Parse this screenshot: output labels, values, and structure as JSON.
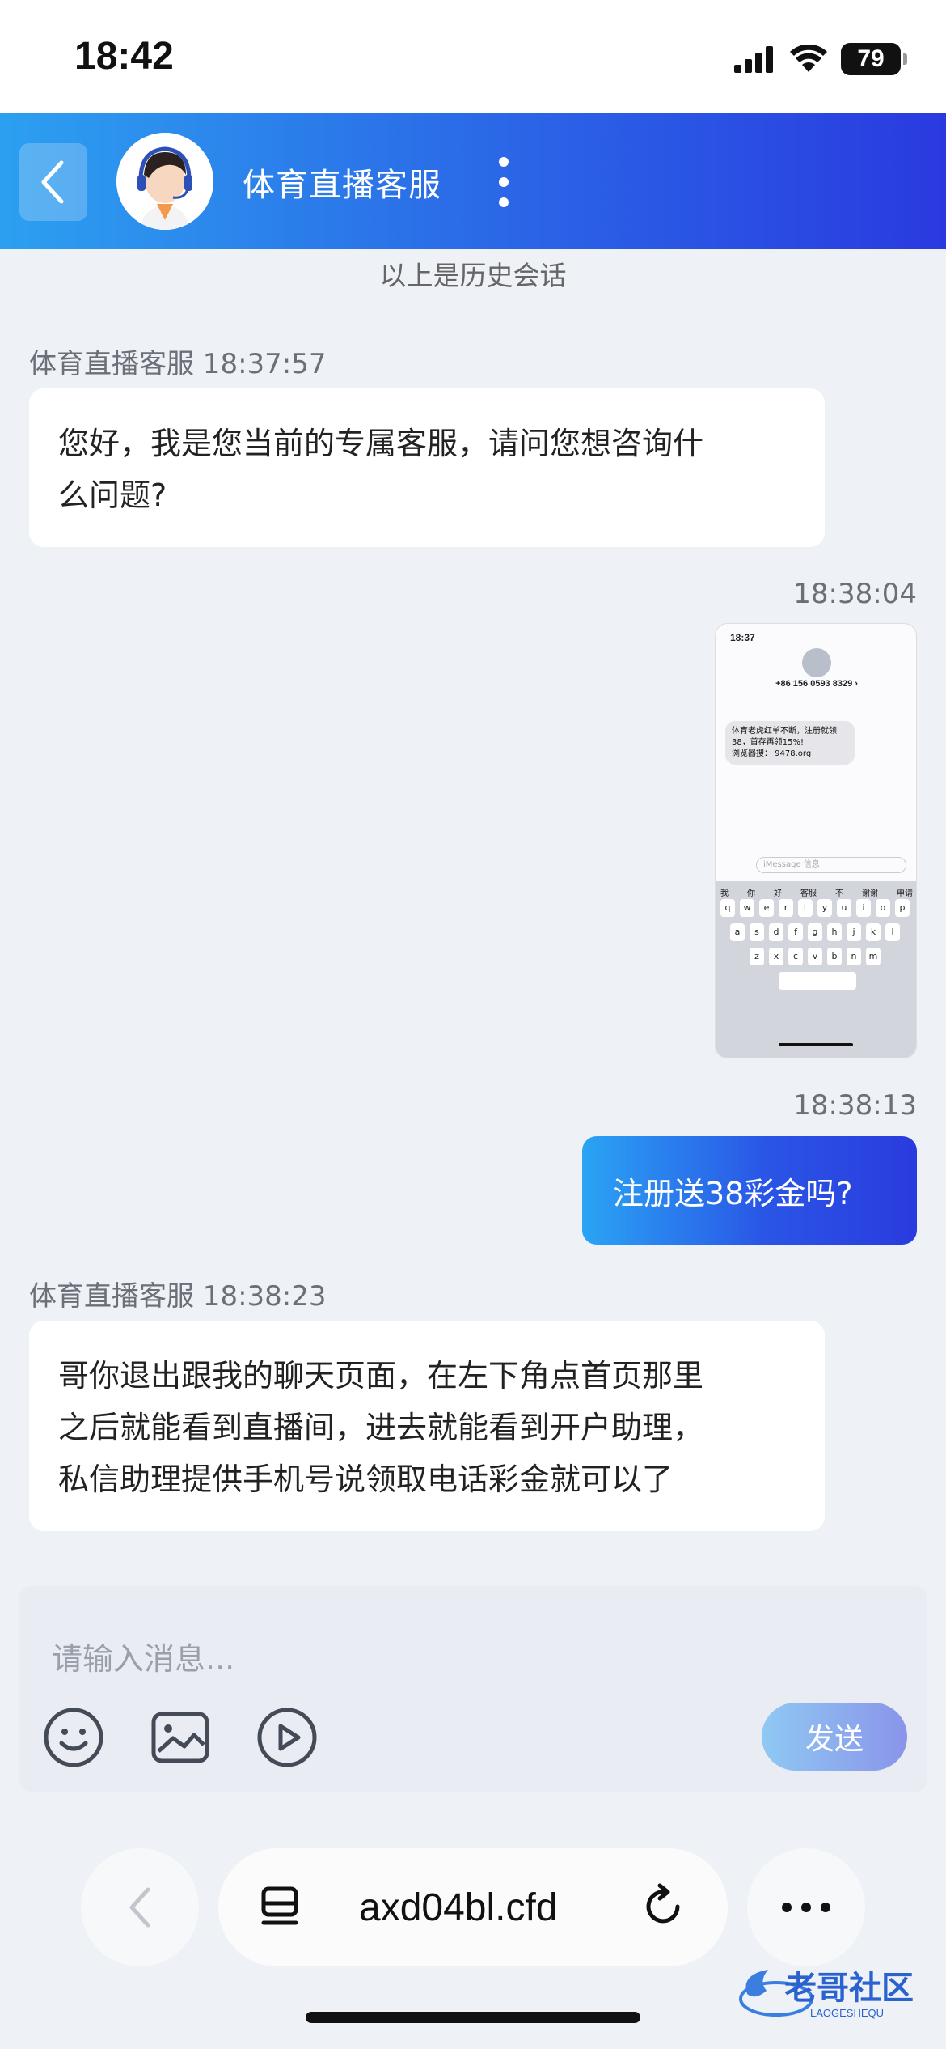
{
  "status_bar": {
    "time": "18:42",
    "battery": "79"
  },
  "header": {
    "title": "体育直播客服"
  },
  "history_label": "以上是历史会话",
  "messages": [
    {
      "sender": "体育直播客服 18:37:57",
      "text_lines": [
        "您好，我是您当前的专属客服，请问您想咨询什",
        "么问题?"
      ]
    },
    {
      "time": "18:38:04"
    },
    {
      "time": "18:38:13",
      "text": "注册送38彩金吗?"
    },
    {
      "sender": "体育直播客服 18:38:23",
      "text_lines": [
        "哥你退出跟我的聊天页面，在左下角点首页那里",
        "之后就能看到直播间，进去就能看到开户助理，",
        "私信助理提供手机号说领取电话彩金就可以了"
      ]
    }
  ],
  "screenshot": {
    "time": "18:37",
    "number": "+86 156 0593 8329 ›",
    "sms_lines": [
      "体育老虎红单不断，注册就领",
      "38，首存再领15%!",
      "浏览器搜：  9478.org"
    ],
    "input_placeholder": "iMessage 信息",
    "suggestions": [
      "我",
      "你",
      "好",
      "客服",
      "不",
      "谢谢",
      "申请"
    ],
    "row1": [
      "q",
      "w",
      "e",
      "r",
      "t",
      "y",
      "u",
      "i",
      "o",
      "p"
    ],
    "row2": [
      "a",
      "s",
      "d",
      "f",
      "g",
      "h",
      "j",
      "k",
      "l"
    ],
    "row3": [
      "z",
      "x",
      "c",
      "v",
      "b",
      "n",
      "m"
    ]
  },
  "composer": {
    "placeholder": "请输入消息...",
    "send_label": "发送"
  },
  "browser": {
    "url": "axd04bl.cfd"
  },
  "watermark": {
    "text": "老哥社区",
    "sub": "LAOGESHEQU"
  },
  "icons": {
    "back": "chevron-left-icon",
    "more": "vertical-dots-icon",
    "emoji": "smiley-icon",
    "image": "image-icon",
    "video": "play-circle-icon",
    "tabs": "tabs-icon",
    "reload": "reload-icon",
    "menu": "horizontal-dots-icon"
  }
}
